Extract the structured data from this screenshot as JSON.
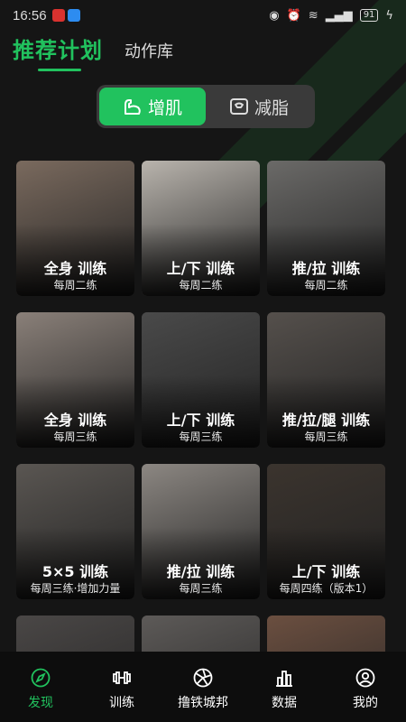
{
  "status_bar": {
    "time": "16:56",
    "battery": "91"
  },
  "top_tabs": {
    "active": "推荐计划",
    "secondary": "动作库"
  },
  "segment": {
    "option_a": "增肌",
    "option_b": "减脂"
  },
  "plans": [
    {
      "title": "全身 训练",
      "subtitle": "每周二练",
      "img_color": "#7a6a5e"
    },
    {
      "title": "上/下 训练",
      "subtitle": "每周二练",
      "img_color": "#b9b4ad"
    },
    {
      "title": "推/拉 训练",
      "subtitle": "每周二练",
      "img_color": "#6b6a68"
    },
    {
      "title": "全身 训练",
      "subtitle": "每周三练",
      "img_color": "#8a8079"
    },
    {
      "title": "上/下 训练",
      "subtitle": "每周三练",
      "img_color": "#4a4a4a"
    },
    {
      "title": "推/拉/腿 训练",
      "subtitle": "每周三练",
      "img_color": "#55504c"
    },
    {
      "title": "5×5 训练",
      "subtitle": "每周三练·增加力量",
      "img_color": "#5a5652"
    },
    {
      "title": "推/拉 训练",
      "subtitle": "每周三练",
      "img_color": "#8c8782"
    },
    {
      "title": "上/下 训练",
      "subtitle": "每周四练（版本1）",
      "img_color": "#3b342e"
    },
    {
      "title": "",
      "subtitle": "",
      "img_color": "#4a4746"
    },
    {
      "title": "",
      "subtitle": "",
      "img_color": "#5d5a58"
    },
    {
      "title": "",
      "subtitle": "",
      "img_color": "#6b4f40"
    }
  ],
  "tabbar": {
    "discover": "发现",
    "train": "训练",
    "community": "撸铁城邦",
    "data": "数据",
    "mine": "我的"
  },
  "colors": {
    "accent": "#21c25e",
    "background": "#151515"
  }
}
